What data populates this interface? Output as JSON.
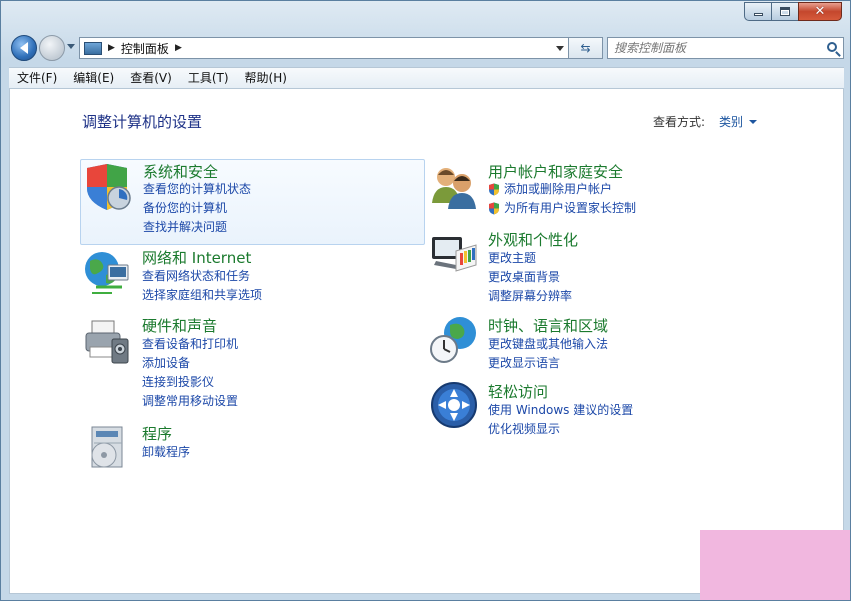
{
  "window": {
    "controls": {
      "minimize": "minimize",
      "maximize": "maximize",
      "close": "close"
    }
  },
  "address": {
    "path": [
      "控制面板"
    ],
    "search_placeholder": "搜索控制面板"
  },
  "menu": [
    "文件(F)",
    "编辑(E)",
    "查看(V)",
    "工具(T)",
    "帮助(H)"
  ],
  "page": {
    "title": "调整计算机的设置",
    "view_by_label": "查看方式:",
    "view_by_value": "类别"
  },
  "categories_left": [
    {
      "title": "系统和安全",
      "icon": "shield-icon",
      "links": [
        "查看您的计算机状态",
        "备份您的计算机",
        "查找并解决问题"
      ]
    },
    {
      "title": "网络和 Internet",
      "icon": "network-globe-icon",
      "links": [
        "查看网络状态和任务",
        "选择家庭组和共享选项"
      ]
    },
    {
      "title": "硬件和声音",
      "icon": "printer-icon",
      "links": [
        "查看设备和打印机",
        "添加设备",
        "连接到投影仪",
        "调整常用移动设置"
      ]
    },
    {
      "title": "程序",
      "icon": "programs-icon",
      "links": [
        "卸载程序"
      ]
    }
  ],
  "categories_right": [
    {
      "title": "用户帐户和家庭安全",
      "icon": "users-icon",
      "links": [
        "添加或删除用户帐户",
        "为所有用户设置家长控制"
      ]
    },
    {
      "title": "外观和个性化",
      "icon": "display-palette-icon",
      "links": [
        "更改主题",
        "更改桌面背景",
        "调整屏幕分辨率"
      ]
    },
    {
      "title": "时钟、语言和区域",
      "icon": "clock-globe-icon",
      "links": [
        "更改键盘或其他输入法",
        "更改显示语言"
      ]
    },
    {
      "title": "轻松访问",
      "icon": "ease-of-access-icon",
      "links": [
        "使用 Windows 建议的设置",
        "优化视频显示"
      ]
    }
  ],
  "colors": {
    "category_title": "#1b7a2e",
    "link": "#1c48a8",
    "page_title": "#1e3287"
  }
}
